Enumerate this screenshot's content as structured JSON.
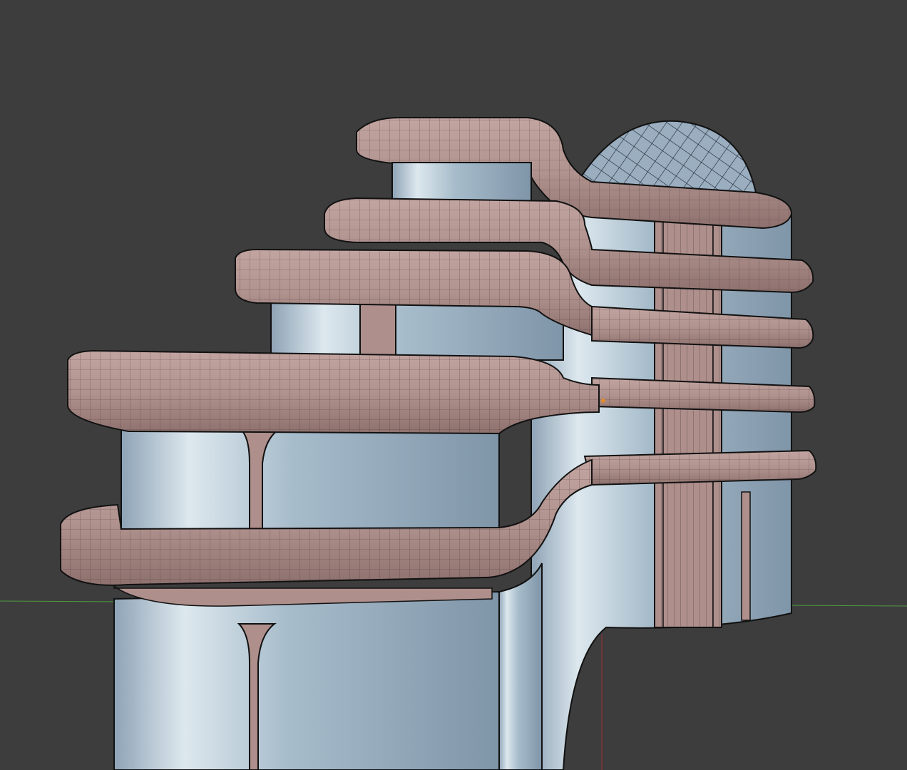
{
  "viewport": {
    "background": "#3d3d3d",
    "x_axis_color": "#4f9a3f",
    "z_axis_color": "#9a3030",
    "origin_color": "#e08a2a"
  },
  "model": {
    "slab_color": "#ae8f8b",
    "slab_dark": "#8d716e",
    "glass_color": "#9db3c6",
    "glass_highlight": "#dde8ee",
    "edge_color": "#111111",
    "dome_color": "#9aaec0"
  }
}
